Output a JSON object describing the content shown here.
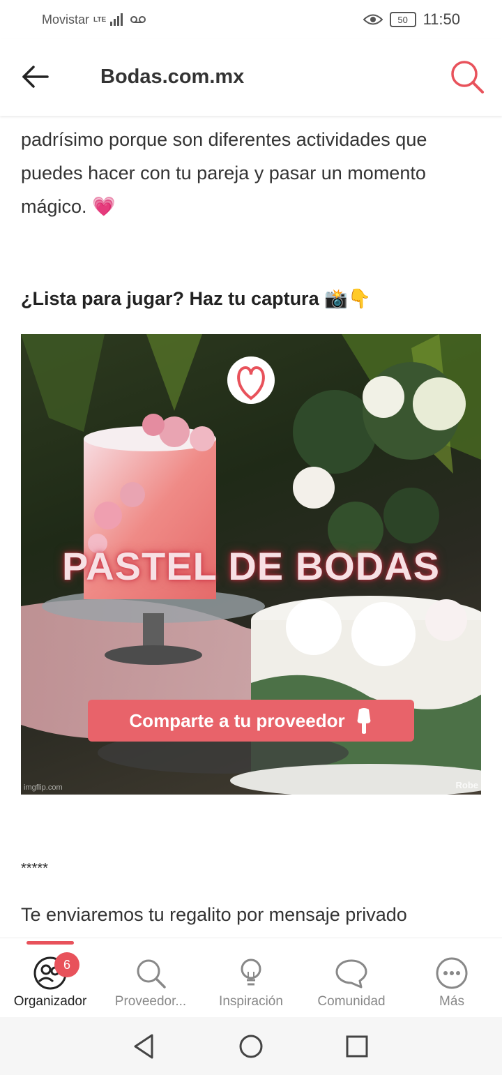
{
  "status": {
    "carrier": "Movistar",
    "network": "LTE",
    "battery": "50",
    "time": "11:50"
  },
  "header": {
    "title": "Bodas.com.mx"
  },
  "article": {
    "intro": "padrísimo porque son diferentes actividades que puedes hacer con tu pareja y pasar un momento mágico. 💗",
    "heading": "¿Lista para jugar? Haz tu captura 📸👇",
    "image": {
      "title": "PASTEL DE BODAS",
      "cta": "Comparte a tu proveedor",
      "watermark_left": "imgflip.com",
      "watermark_right": "Robe"
    },
    "stars": "*****",
    "footer_text": "Te enviaremos tu regalito por mensaje privado"
  },
  "bottom_nav": {
    "items": [
      {
        "label": "Organizador",
        "icon": "organizer-icon",
        "badge": "6",
        "active": true
      },
      {
        "label": "Proveedor...",
        "icon": "search-icon"
      },
      {
        "label": "Inspiración",
        "icon": "lightbulb-icon"
      },
      {
        "label": "Comunidad",
        "icon": "chat-bubble-icon"
      },
      {
        "label": "Más",
        "icon": "more-icon"
      }
    ]
  },
  "colors": {
    "accent": "#e8525b",
    "text": "#333333",
    "muted": "#888888"
  }
}
